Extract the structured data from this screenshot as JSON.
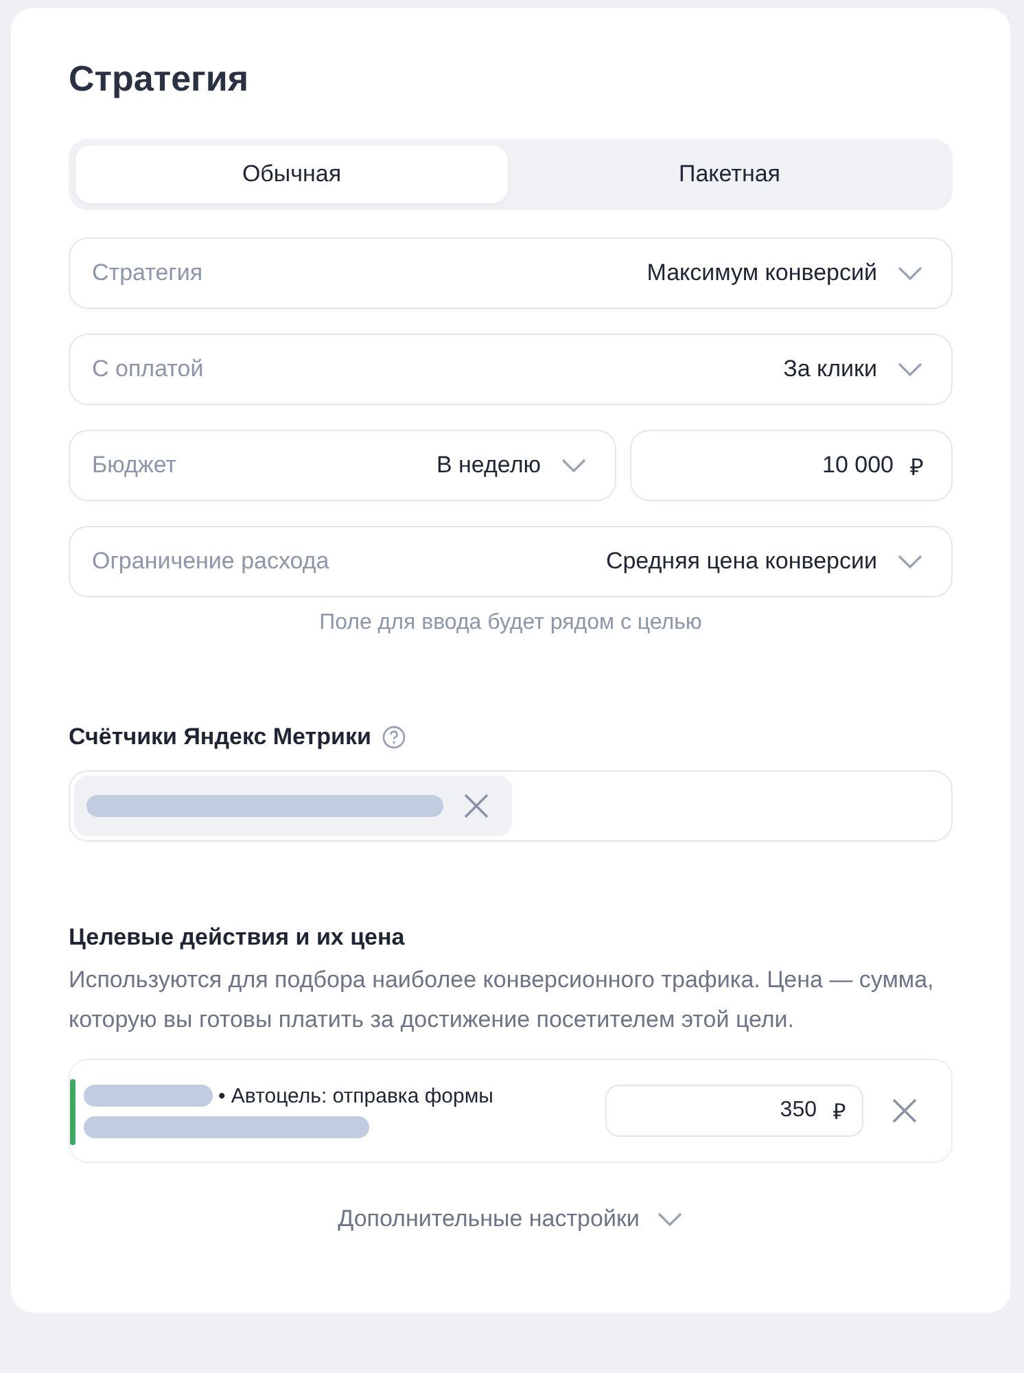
{
  "title": "Стратегия",
  "tabs": [
    {
      "label": "Обычная",
      "selected": true
    },
    {
      "label": "Пакетная",
      "selected": false
    }
  ],
  "fields": [
    {
      "label": "Стратегия",
      "value": "Максимум конверсий"
    },
    {
      "label": "С оплатой",
      "value": "За клики"
    }
  ],
  "budget": {
    "label": "Бюджет",
    "value": "В неделю",
    "amount": "10 000",
    "currency": "₽"
  },
  "limit": {
    "label": "Ограничение расхода",
    "value": "Средняя цена конверсии"
  },
  "hint": "Поле для ввода будет рядом с целью",
  "counters": {
    "label": "Счётчики Яндекс Метрики"
  },
  "goals": {
    "title": "Целевые действия и их цена",
    "description": "Используются для подбора наиболее конверсионного трафика. Цена — сумма, которую вы готовы платить за достижение посетителем этой цели.",
    "items": [
      {
        "text": "• Автоцель: отправка формы",
        "color": "#3fa764",
        "price": "350",
        "currency": "₽"
      }
    ]
  },
  "more": "Дополнительные настройки"
}
